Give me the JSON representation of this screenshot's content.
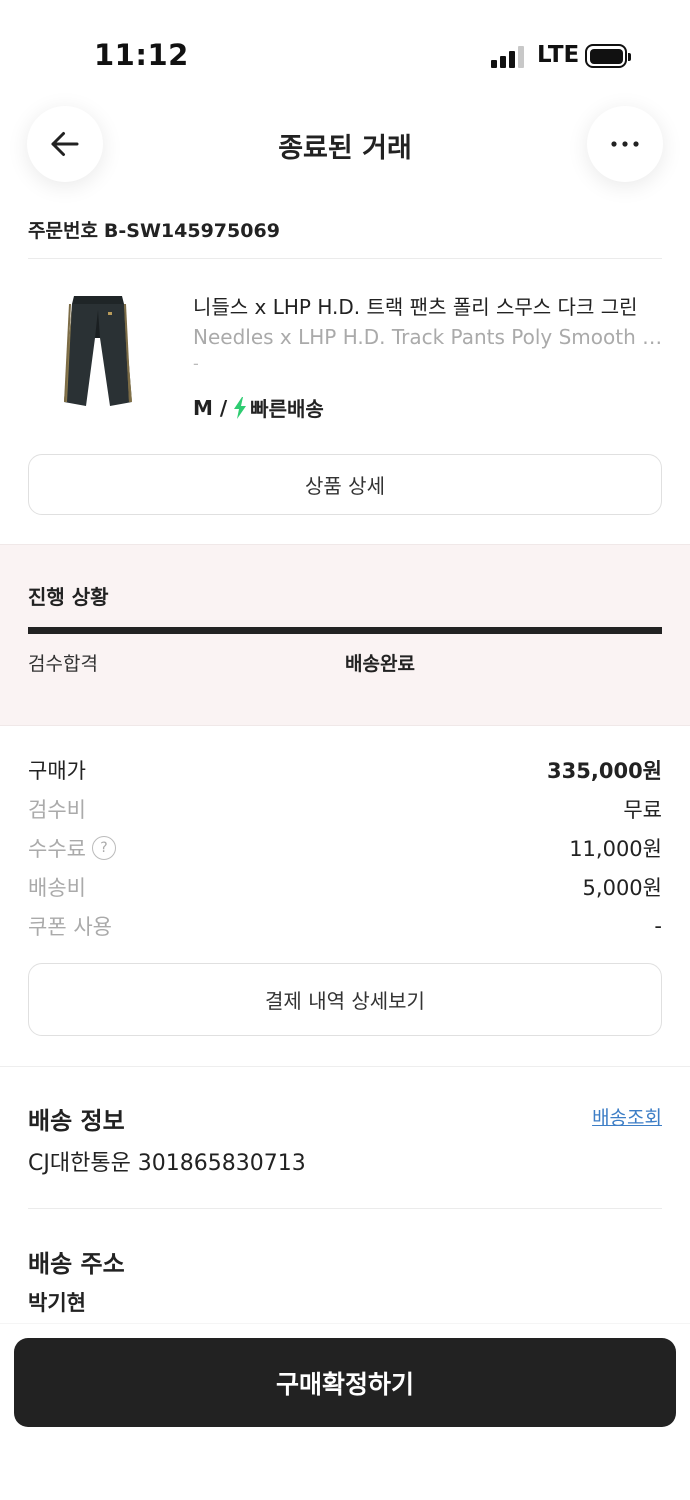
{
  "status_bar": {
    "time": "11:12",
    "network": "LTE",
    "signal_bars": 3,
    "battery_level": 1.0
  },
  "header": {
    "title": "종료된 거래",
    "back_icon": "arrow-left-icon",
    "more_icon": "more-horizontal-icon"
  },
  "order": {
    "label": "주문번호",
    "number": "B-SW145975069"
  },
  "product": {
    "name_ko": "니들스 x LHP H.D. 트랙 팬츠 폴리 스무스 다크 그린",
    "name_en": "Needles x LHP H.D. Track Pants Poly Smooth Dark Green",
    "model": "-",
    "size": "M /",
    "delivery_type": "빠른배송",
    "delivery_icon": "lightning-icon",
    "bolt_color": "#2ecc71",
    "detail_button": "상품 상세"
  },
  "progress": {
    "title": "진행 상황",
    "steps": [
      {
        "label": "검수합격"
      },
      {
        "label": "배송완료"
      }
    ],
    "completed": 1.0
  },
  "price": {
    "purchase_label": "구매가",
    "purchase_value": "335,000원",
    "inspection_label": "검수비",
    "inspection_value": "무료",
    "fee_label": "수수료",
    "fee_value": "11,000원",
    "shipping_label": "배송비",
    "shipping_value": "5,000원",
    "coupon_label": "쿠폰 사용",
    "coupon_value": "-",
    "detail_button": "결제 내역 상세보기"
  },
  "shipping": {
    "title": "배송 정보",
    "track_link": "배송조회",
    "courier_tracking": "CJ대한통운 301865830713"
  },
  "address": {
    "title": "배송 주소",
    "name": "박기현"
  },
  "footer": {
    "confirm_button": "구매확정하기"
  }
}
